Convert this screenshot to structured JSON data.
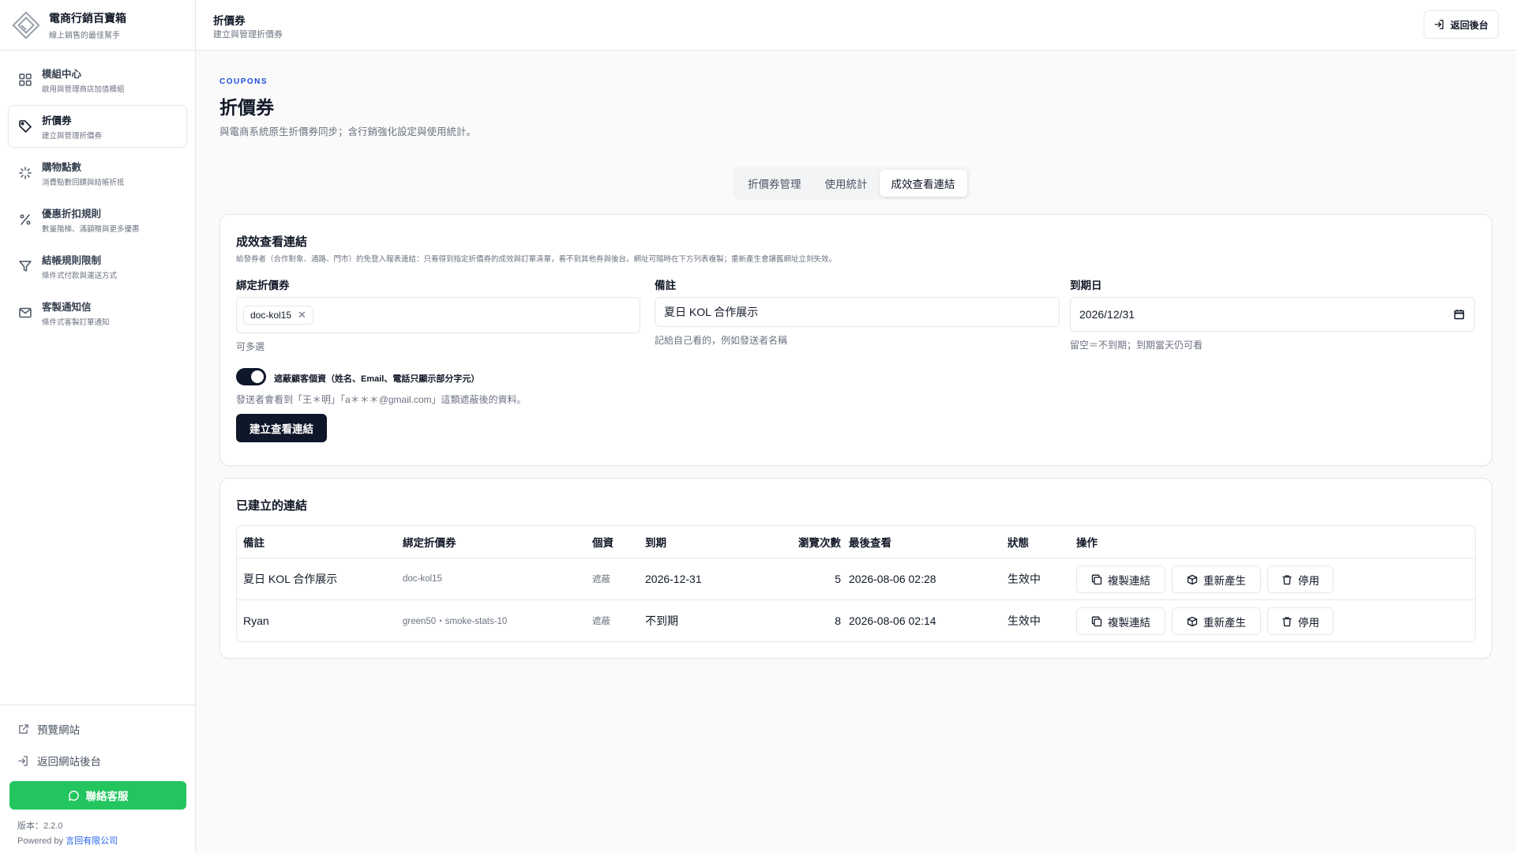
{
  "brand": {
    "title": "電商行銷百寶箱",
    "subtitle": "線上銷售的最佳幫手"
  },
  "sidebar": {
    "items": [
      {
        "label": "模組中心",
        "desc": "啟用與管理商店加值模組",
        "icon": "grid-icon"
      },
      {
        "label": "折價券",
        "desc": "建立與管理折價券",
        "icon": "tag-icon",
        "active": true
      },
      {
        "label": "購物點數",
        "desc": "消費點數回饋與結帳折抵",
        "icon": "sparkle-icon"
      },
      {
        "label": "優惠折扣規則",
        "desc": "數量階梯、滿額贈與更多優惠",
        "icon": "percent-icon"
      },
      {
        "label": "結帳規則限制",
        "desc": "條件式付款與運送方式",
        "icon": "filter-icon"
      },
      {
        "label": "客製通知信",
        "desc": "條件式客製訂單通知",
        "icon": "mail-icon"
      }
    ],
    "preview_site": "預覽網站",
    "back_to_site_admin": "返回網站後台",
    "support": "聯絡客服",
    "version": "版本：2.2.0",
    "powered_prefix": "Powered by",
    "powered_company": "言回有限公司"
  },
  "topbar": {
    "title": "折價券",
    "subtitle": "建立與管理折價券",
    "back_button": "返回後台"
  },
  "page": {
    "eyebrow": "COUPONS",
    "title": "折價券",
    "description": "與電商系統原生折價券同步；含行銷強化設定與使用統計。"
  },
  "tabs": [
    {
      "label": "折價券管理"
    },
    {
      "label": "使用統計"
    },
    {
      "label": "成效查看連結",
      "active": true
    }
  ],
  "form": {
    "title": "成效查看連結",
    "description": "給發券者（合作對象、通路、門市）的免登入報表連結：只看得到指定折價券的成效與訂單清單，看不到其他券與後台。網址可隨時在下方列表複製；重新產生會讓舊網址立刻失效。",
    "coupon_label": "綁定折價券",
    "coupon_chip": "doc-kol15",
    "coupon_help": "可多選",
    "note_label": "備註",
    "note_value": "夏日 KOL 合作展示",
    "note_help": "記給自己看的，例如發送者名稱",
    "expiry_label": "到期日",
    "expiry_value": "2026/12/31",
    "expiry_help": "留空＝不到期；到期當天仍可看",
    "mask_label": "遮蔽顧客個資（姓名、Email、電話只顯示部分字元）",
    "mask_enabled": true,
    "mask_help": "發送者會看到「王＊明」「a＊＊＊@gmail.com」這類遮蔽後的資料。",
    "create_button": "建立查看連結"
  },
  "links": {
    "title": "已建立的連結",
    "headers": [
      "備註",
      "綁定折價券",
      "個資",
      "到期",
      "瀏覽次數",
      "最後查看",
      "狀態",
      "操作"
    ],
    "rows": [
      {
        "note": "夏日 KOL 合作展示",
        "coupons": "doc-kol15",
        "privacy": "遮蔽",
        "expiry": "2026-12-31",
        "views": "5",
        "last_viewed": "2026-08-06 02:28",
        "status": "生效中"
      },
      {
        "note": "Ryan",
        "coupons": "green50・smoke-stats-10",
        "privacy": "遮蔽",
        "expiry": "不到期",
        "views": "8",
        "last_viewed": "2026-08-06 02:14",
        "status": "生效中"
      }
    ],
    "actions": {
      "copy": "複製連結",
      "regenerate": "重新產生",
      "disable": "停用"
    }
  }
}
